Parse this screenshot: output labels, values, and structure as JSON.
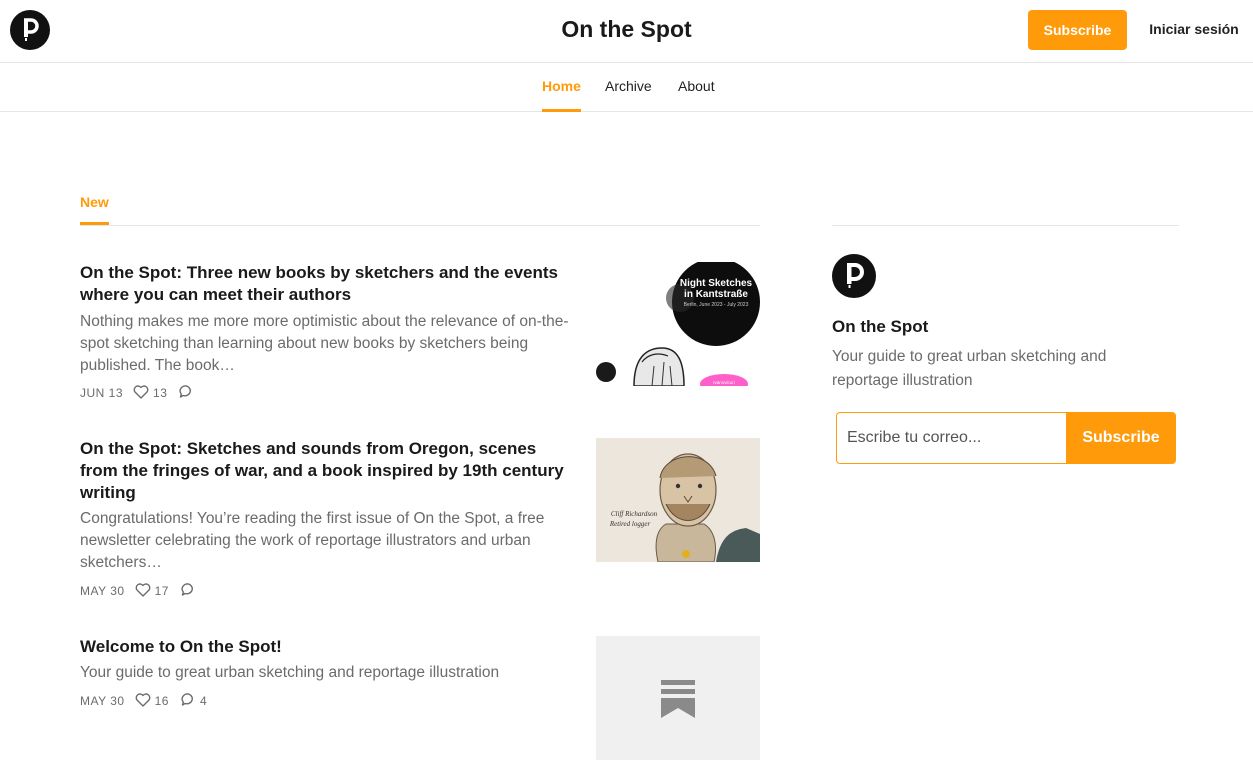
{
  "header": {
    "site_title": "On the Spot",
    "subscribe_label": "Subscribe",
    "signin_label": "Iniciar sesión",
    "logo_icon": "publication-logo-p",
    "accent_color": "#ff9a0a"
  },
  "nav": {
    "items": [
      {
        "label": "Home",
        "active": true
      },
      {
        "label": "Archive",
        "active": false
      },
      {
        "label": "About",
        "active": false
      }
    ]
  },
  "tabs": {
    "active_label": "New"
  },
  "posts": [
    {
      "title": "On the Spot: Three new books by sketchers and the events where you can meet their authors",
      "subtitle": "Nothing makes me more more optimistic about the relevance of on-the-spot sketching than learning about new books by sketchers being published. The book…",
      "date": "JUN 13",
      "likes": "13",
      "comments": "",
      "thumb_text_1": "Night Sketches",
      "thumb_text_2": "in Kantstraße",
      "thumb_text_3": "Berlin, June 2023 - July 2023",
      "thumb_text_4": "Ivanovicuri"
    },
    {
      "title": "On the Spot: Sketches and sounds from Oregon, scenes from the fringes of war, and a book inspired by 19th century writing",
      "subtitle": "Congratulations! You’re reading the first issue of On the Spot, a free newsletter celebrating the work of reportage illustrators and urban sketchers…",
      "date": "MAY 30",
      "likes": "17",
      "comments": "",
      "thumb_text_1": "Cliff Richardson",
      "thumb_text_2": "Retired logger"
    },
    {
      "title": "Welcome to On the Spot!",
      "subtitle": "Your guide to great urban sketching and reportage illustration",
      "date": "MAY 30",
      "likes": "16",
      "comments": "4",
      "thumb_icon": "substack-bookmark-icon"
    }
  ],
  "sidebar": {
    "title": "On the Spot",
    "description": "Your guide to great urban sketching and reportage illustration",
    "email_placeholder": "Escribe tu correo...",
    "subscribe_label": "Subscribe"
  }
}
